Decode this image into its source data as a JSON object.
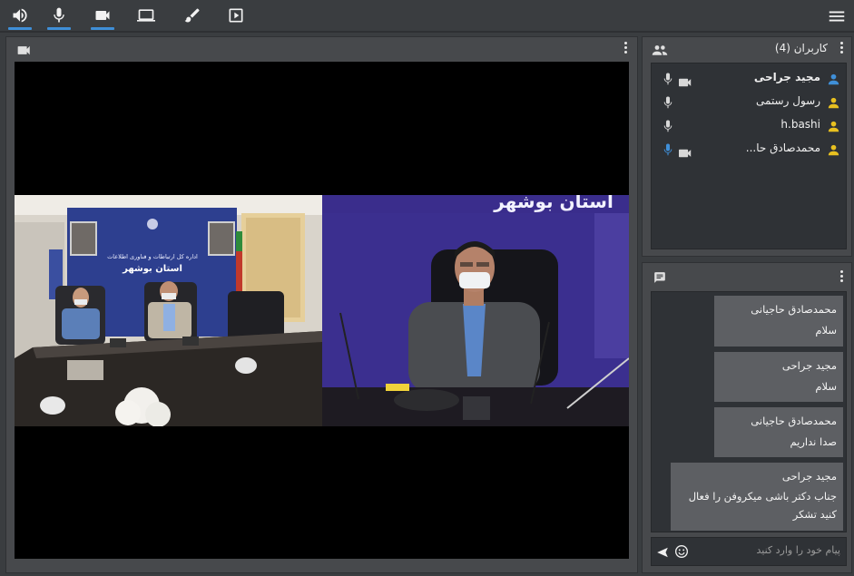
{
  "toolbar": {
    "buttons": [
      {
        "name": "speaker-button",
        "icon": "speaker-icon",
        "active": true
      },
      {
        "name": "microphone-button",
        "icon": "microphone-icon",
        "active": true
      },
      {
        "name": "camera-button",
        "icon": "camera-icon",
        "active": true
      },
      {
        "name": "screen-share-button",
        "icon": "laptop-icon",
        "active": false
      },
      {
        "name": "whiteboard-button",
        "icon": "brush-icon",
        "active": false
      },
      {
        "name": "play-media-button",
        "icon": "play-icon",
        "active": false
      }
    ],
    "menu_icon": "hamburger-icon",
    "accent": "#3f8fd8"
  },
  "video": {
    "header_icon": "camera-icon",
    "left_feed": {
      "backdrop_line1": "اداره کل ارتباطات و فناوری اطلاعات",
      "backdrop_line2": "استان بوشهر"
    },
    "right_feed": {
      "banner_text": "استان بوشهر"
    }
  },
  "users": {
    "title": "کاربران (4)",
    "header_icon": "people-icon",
    "list": [
      {
        "name": "مجید جراحی",
        "avatar_color": "#3f8fd8",
        "mic": true,
        "mic_active": false,
        "camera": true,
        "is_self": true
      },
      {
        "name": "رسول رستمی",
        "avatar_color": "#e8c020",
        "mic": true,
        "mic_active": false,
        "camera": false,
        "is_self": false
      },
      {
        "name": "h.bashi",
        "avatar_color": "#e8c020",
        "mic": true,
        "mic_active": false,
        "camera": false,
        "is_self": false
      },
      {
        "name": "محمدصادق حا...",
        "avatar_color": "#e8c020",
        "mic": true,
        "mic_active": true,
        "camera": true,
        "is_self": false
      }
    ]
  },
  "chat": {
    "header_icon": "chat-bubble-icon",
    "messages": [
      {
        "sender": "محمدصادق حاجیانی",
        "text": "سلام"
      },
      {
        "sender": "مجید جراحی",
        "text": "سلام"
      },
      {
        "sender": "محمدصادق حاجیانی",
        "text": "صدا نداریم"
      },
      {
        "sender": "مجید جراحی",
        "text": "جناب دکتر باشی میکروفن را فعال کنید تشکر"
      }
    ],
    "input_placeholder": "پیام خود را وارد کنید",
    "input_value": ""
  }
}
